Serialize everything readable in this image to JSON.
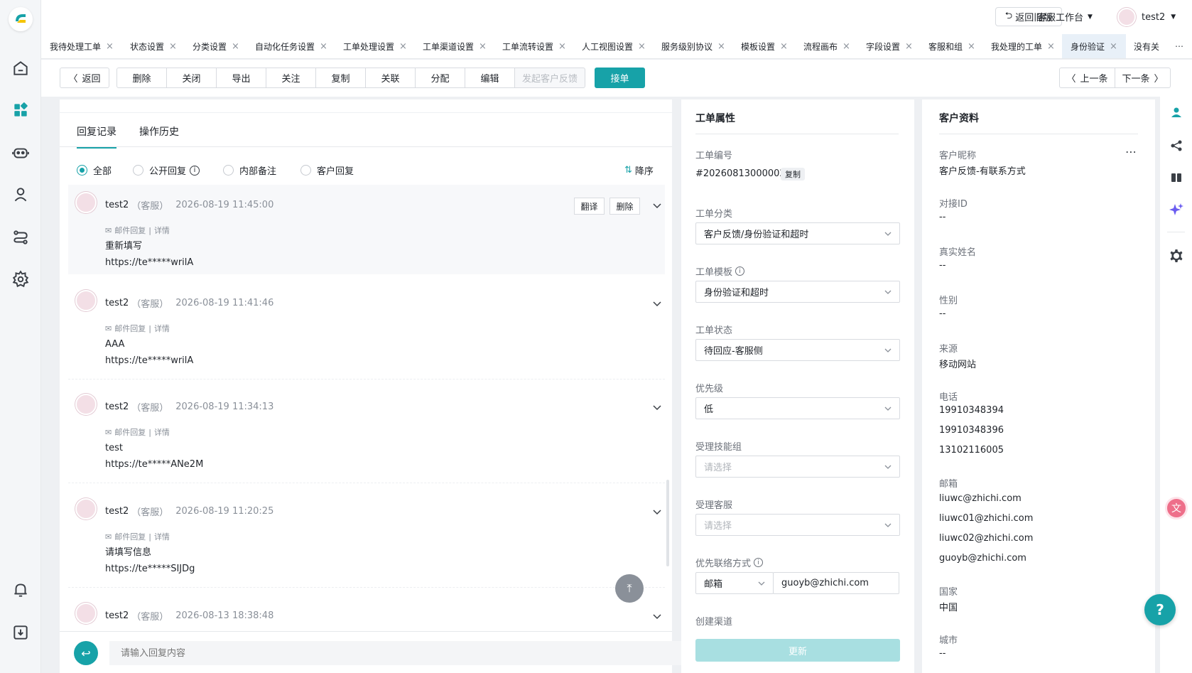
{
  "topbar": {
    "old_version_label": "返回旧版",
    "workspace_label": "客服工作台",
    "user_name": "test2"
  },
  "tabs": [
    {
      "label": "我待处理工单"
    },
    {
      "label": "状态设置"
    },
    {
      "label": "分类设置"
    },
    {
      "label": "自动化任务设置"
    },
    {
      "label": "工单处理设置"
    },
    {
      "label": "工单渠道设置"
    },
    {
      "label": "工单流转设置"
    },
    {
      "label": "人工视图设置"
    },
    {
      "label": "服务级别协议"
    },
    {
      "label": "模板设置"
    },
    {
      "label": "流程画布"
    },
    {
      "label": "字段设置"
    },
    {
      "label": "客服和组"
    },
    {
      "label": "我处理的工单"
    },
    {
      "label": "身份验证"
    },
    {
      "label": "没有关"
    }
  ],
  "toolbar": {
    "back": "返回",
    "delete": "删除",
    "close": "关闭",
    "export": "导出",
    "follow": "关注",
    "copy": "复制",
    "link": "关联",
    "assign": "分配",
    "edit": "编辑",
    "feedback": "发起客户反馈",
    "accept": "接单",
    "prev": "上一条",
    "next": "下一条"
  },
  "reply": {
    "tab_records": "回复记录",
    "tab_history": "操作历史",
    "filters": {
      "all": "全部",
      "public": "公开回复",
      "internal": "内部备注",
      "customer": "客户回复"
    },
    "sort_label": "降序",
    "translate": "翻译",
    "delete": "删除",
    "input_placeholder": "请输入回复内容",
    "messages": [
      {
        "name": "test2",
        "role": "（客服）",
        "time": "2026-08-19 11:45:00",
        "sub": "邮件回复",
        "detail": "详情",
        "line1": "重新填写",
        "line2": "https://te*****wrilA"
      },
      {
        "name": "test2",
        "role": "（客服）",
        "time": "2026-08-19 11:41:46",
        "sub": "邮件回复",
        "detail": "详情",
        "line1": "AAA",
        "line2": "https://te*****wrilA"
      },
      {
        "name": "test2",
        "role": "（客服）",
        "time": "2026-08-19 11:34:13",
        "sub": "邮件回复",
        "detail": "详情",
        "line1": "test",
        "line2": "https://te*****ANe2M"
      },
      {
        "name": "test2",
        "role": "（客服）",
        "time": "2026-08-19 11:20:25",
        "sub": "邮件回复",
        "detail": "详情",
        "line1": "请填写信息",
        "line2": "https://te*****SIJDg"
      },
      {
        "name": "test2",
        "role": "（客服）",
        "time": "2026-08-13 18:38:48"
      }
    ]
  },
  "props": {
    "title": "工单属性",
    "ticket_no_label": "工单编号",
    "ticket_no": "#20260813000002",
    "copy": "复制",
    "category_label": "工单分类",
    "category": "客户反馈/身份验证和超时",
    "template_label": "工单模板",
    "template": "身份验证和超时",
    "status_label": "工单状态",
    "status": "待回应-客服侧",
    "priority_label": "优先级",
    "priority": "低",
    "skill_group_label": "受理技能组",
    "skill_group_placeholder": "请选择",
    "agent_label": "受理客服",
    "agent_placeholder": "请选择",
    "contact_label": "优先联络方式",
    "contact_type": "邮箱",
    "contact_value": "guoyb@zhichi.com",
    "channel_label": "创建渠道",
    "update": "更新"
  },
  "customer": {
    "title": "客户资料",
    "nickname_label": "客户昵称",
    "nickname": "客户反馈-有联系方式",
    "dock_label": "对接ID",
    "dock": "--",
    "realname_label": "真实姓名",
    "realname": "--",
    "gender_label": "性别",
    "gender": "--",
    "source_label": "来源",
    "source": "移动网站",
    "phone_label": "电话",
    "phones": [
      "19910348394",
      "19910348396",
      "13102116005"
    ],
    "email_label": "邮箱",
    "emails": [
      "liuwc@zhichi.com",
      "liuwc01@zhichi.com",
      "liuwc02@zhichi.com",
      "guoyb@zhichi.com"
    ],
    "country_label": "国家",
    "country": "中国",
    "city_label": "城市",
    "city": "--"
  },
  "colors": {
    "accent": "#17a2a8",
    "accent_light": "#a8dfe1"
  }
}
